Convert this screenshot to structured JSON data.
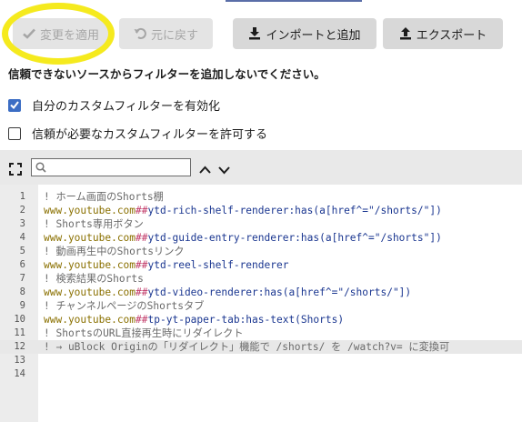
{
  "toolbar": {
    "apply_label": "変更を適用",
    "revert_label": "元に戻す",
    "import_label": "インポートと追加",
    "export_label": "エクスポート"
  },
  "warning_text": "信頼できないソースからフィルターを追加しないでください。",
  "options": [
    {
      "label": "自分のカスタムフィルターを有効化",
      "checked": true
    },
    {
      "label": "信頼が必要なカスタムフィルターを許可する",
      "checked": false
    }
  ],
  "search": {
    "placeholder": ""
  },
  "icons": {
    "apply": "check-icon",
    "revert": "undo-icon",
    "import": "download-icon",
    "export": "upload-icon",
    "fullscreen": "fullscreen-icon",
    "search": "search-icon",
    "prev": "chevron-up-icon",
    "next": "chevron-down-icon"
  },
  "colors": {
    "highlight_circle": "#f5ea1e",
    "checkbox_checked": "#3b6dc4",
    "comment": "#6a6a6a",
    "domain": "#8a7000",
    "separator": "#c23c6a",
    "selector": "#1a3690"
  },
  "editor": {
    "active_line": 12,
    "lines": [
      {
        "num": "1",
        "type": "comment",
        "text": "! ホーム画面のShorts棚"
      },
      {
        "num": "2",
        "type": "rule",
        "domain": "www.youtube.com",
        "sep": "##",
        "selector": "ytd-rich-shelf-renderer:has(a[href^=\"/shorts/\"])"
      },
      {
        "num": "3",
        "type": "comment",
        "text": "! Shorts専用ボタン"
      },
      {
        "num": "4",
        "type": "rule",
        "domain": "www.youtube.com",
        "sep": "##",
        "selector": "ytd-guide-entry-renderer:has(a[href^=\"/shorts\"])"
      },
      {
        "num": "5",
        "type": "comment",
        "text": "! 動画再生中のShortsリンク"
      },
      {
        "num": "6",
        "type": "rule",
        "domain": "www.youtube.com",
        "sep": "##",
        "selector": "ytd-reel-shelf-renderer"
      },
      {
        "num": "7",
        "type": "comment",
        "text": "! 検索結果のShorts"
      },
      {
        "num": "8",
        "type": "rule",
        "domain": "www.youtube.com",
        "sep": "##",
        "selector": "ytd-video-renderer:has(a[href^=\"/shorts/\"])"
      },
      {
        "num": "9",
        "type": "comment",
        "text": "! チャンネルページのShortsタブ"
      },
      {
        "num": "10",
        "type": "rule",
        "domain": "www.youtube.com",
        "sep": "##",
        "selector": "tp-yt-paper-tab:has-text(Shorts)"
      },
      {
        "num": "11",
        "type": "comment",
        "text": "! ShortsのURL直接再生時にリダイレクト"
      },
      {
        "num": "12",
        "type": "comment",
        "text": "! → uBlock Originの「リダイレクト」機能で /shorts/ を /watch?v= に変換可"
      },
      {
        "num": "13",
        "type": "empty",
        "text": ""
      },
      {
        "num": "14",
        "type": "empty",
        "text": ""
      }
    ]
  }
}
